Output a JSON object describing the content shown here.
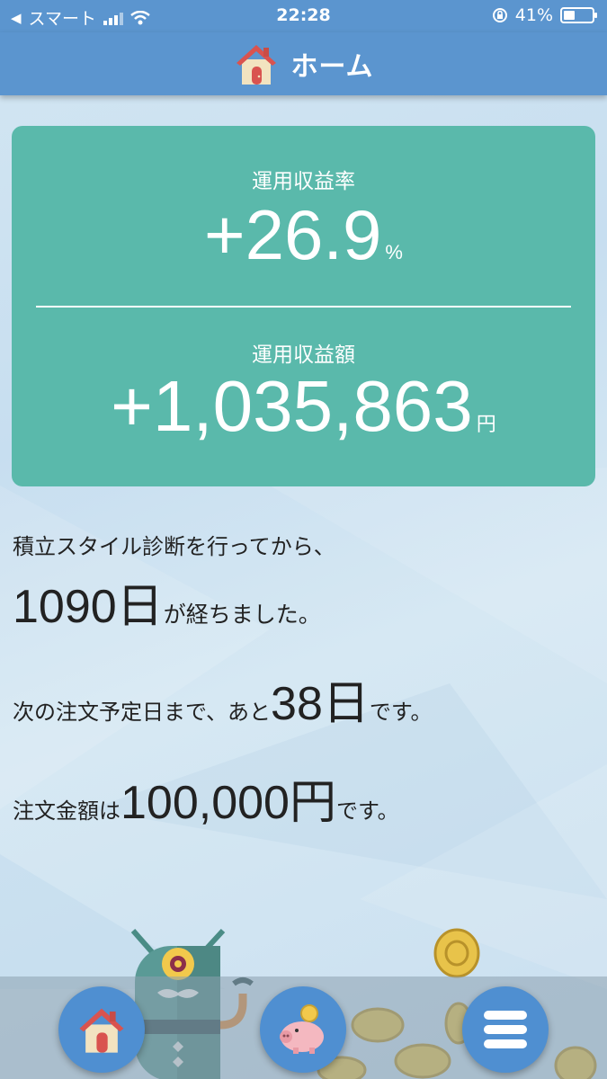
{
  "status_bar": {
    "carrier": "スマート",
    "time": "22:28",
    "battery_percent": "41%",
    "battery_level": 0.41,
    "icons": [
      "back-arrow-icon",
      "signal-icon",
      "wifi-icon",
      "rotation-lock-icon",
      "battery-icon"
    ]
  },
  "header": {
    "title": "ホーム",
    "icon": "house-icon"
  },
  "profit_card": {
    "rate_label": "運用収益率",
    "rate_value": "+26.9",
    "rate_unit": "%",
    "amount_label": "運用収益額",
    "amount_value": "+1,035,863",
    "amount_unit": "円",
    "background_color": "#5ab9ab"
  },
  "info": {
    "line1": "積立スタイル診断を行ってから、",
    "days_elapsed": "1090日",
    "days_elapsed_suffix": "が経ちました。",
    "next_order_prefix": "次の注文予定日まで、あと",
    "next_order_days": "38日",
    "next_order_suffix": "です。",
    "order_amount_prefix": "注文金額は",
    "order_amount": "100,000円",
    "order_amount_suffix": "です。"
  },
  "bottom_nav": {
    "buttons": [
      {
        "icon": "house-icon"
      },
      {
        "icon": "piggy-bank-icon"
      },
      {
        "icon": "menu-icon"
      }
    ]
  },
  "colors": {
    "header_blue": "#5b95cf",
    "card_teal": "#5ab9ab",
    "button_blue": "#4f8fd1"
  }
}
